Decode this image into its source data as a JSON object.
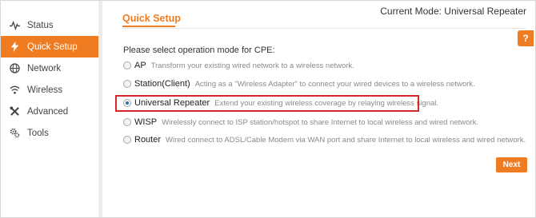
{
  "header": {
    "current_mode": "Current Mode: Universal Repeater"
  },
  "sidebar": {
    "items": [
      {
        "label": "Status",
        "icon": "pulse-icon",
        "active": false
      },
      {
        "label": "Quick Setup",
        "icon": "lightning-icon",
        "active": true
      },
      {
        "label": "Network",
        "icon": "globe-icon",
        "active": false
      },
      {
        "label": "Wireless",
        "icon": "wifi-icon",
        "active": false
      },
      {
        "label": "Advanced",
        "icon": "tools-cross-icon",
        "active": false
      },
      {
        "label": "Tools",
        "icon": "gears-icon",
        "active": false
      }
    ]
  },
  "main": {
    "title": "Quick Setup",
    "help_label": "?",
    "prompt": "Please select operation mode for CPE:",
    "selected_mode": "Universal Repeater",
    "options": [
      {
        "name": "AP",
        "desc": "Transform your existing wired network to a wireless network."
      },
      {
        "name": "Station(Client)",
        "desc": "Acting as a \"Wireless Adapter\" to connect your wired devices to a wireless network."
      },
      {
        "name": "Universal Repeater",
        "desc": "Extend your existing wireless coverage by relaying wireless signal."
      },
      {
        "name": "WISP",
        "desc": "Wirelessly connect to ISP station/hotspot to share Internet to local wireless and wired network."
      },
      {
        "name": "Router",
        "desc": "Wired connect to ADSL/Cable Modem via WAN port and share Internet to local wireless and wired network."
      }
    ],
    "next_label": "Next"
  },
  "colors": {
    "accent": "#f07c21",
    "highlight_border": "#d6262b",
    "radio_selected": "#2a6fb5"
  }
}
